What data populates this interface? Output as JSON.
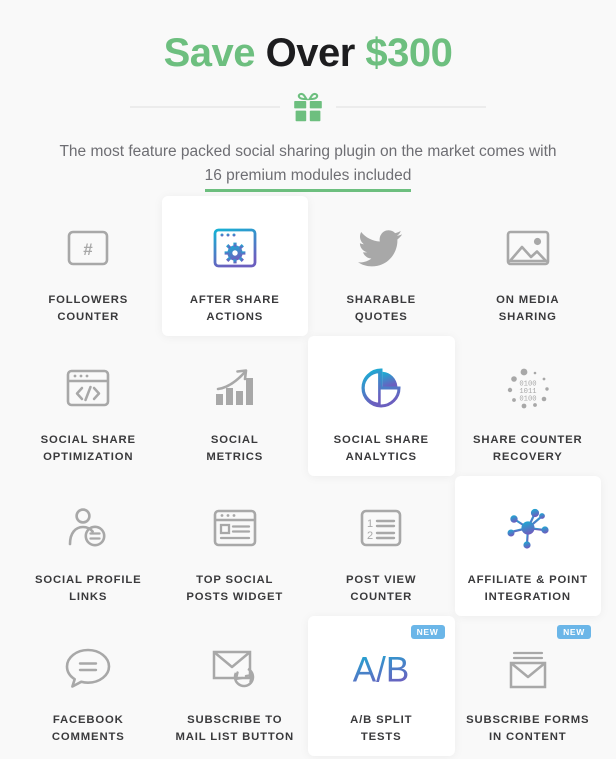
{
  "header": {
    "title_part1": "Save",
    "title_part2": "Over",
    "title_part3": "$300",
    "gift_icon": "gift-icon",
    "subtitle_line1": "The most feature packed social sharing plugin on the market comes with",
    "subtitle_highlight": "16 premium modules included"
  },
  "colors": {
    "green": "#6dbf7f",
    "dark": "#1d1d1f",
    "label": "#3a3a3c",
    "subtitle": "#6e6e73",
    "badge_blue": "#6bb6e8",
    "gradient_start": "#16b1d4",
    "gradient_end": "#6b5fbf",
    "icon_gray": "#a8a8a8",
    "page_bg": "#f9f9f9",
    "card_bg": "#ffffff"
  },
  "modules": [
    {
      "label": "FOLLOWERS\nCOUNTER",
      "icon": "hash-square-icon",
      "featured": false,
      "badge": null
    },
    {
      "label": "AFTER SHARE\nACTIONS",
      "icon": "browser-gear-icon",
      "featured": true,
      "badge": null
    },
    {
      "label": "SHARABLE\nQUOTES",
      "icon": "twitter-bird-icon",
      "featured": false,
      "badge": null
    },
    {
      "label": "ON MEDIA\nSHARING",
      "icon": "image-photo-icon",
      "featured": false,
      "badge": null
    },
    {
      "label": "SOCIAL SHARE\nOPTIMIZATION",
      "icon": "browser-code-icon",
      "featured": false,
      "badge": null
    },
    {
      "label": "SOCIAL\nMETRICS",
      "icon": "bar-chart-arrow-icon",
      "featured": false,
      "badge": null
    },
    {
      "label": "SOCIAL SHARE\nANALYTICS",
      "icon": "pie-chart-icon",
      "featured": true,
      "badge": null
    },
    {
      "label": "SHARE COUNTER\nRECOVERY",
      "icon": "binary-dots-icon",
      "featured": false,
      "badge": null
    },
    {
      "label": "SOCIAL PROFILE\nLINKS",
      "icon": "person-chat-icon",
      "featured": false,
      "badge": null
    },
    {
      "label": "TOP SOCIAL\nPOSTS WIDGET",
      "icon": "browser-list-icon",
      "featured": false,
      "badge": null
    },
    {
      "label": "POST VIEW\nCOUNTER",
      "icon": "numbered-list-icon",
      "featured": false,
      "badge": null
    },
    {
      "label": "AFFILIATE & POINT\nINTEGRATION",
      "icon": "network-nodes-icon",
      "featured": true,
      "badge": null
    },
    {
      "label": "FACEBOOK\nCOMMENTS",
      "icon": "chat-bubble-icon",
      "featured": false,
      "badge": null
    },
    {
      "label": "SUBSCRIBE TO\nMAIL LIST BUTTON",
      "icon": "envelope-refresh-icon",
      "featured": false,
      "badge": null
    },
    {
      "label": "A/B SPLIT\nTESTS",
      "icon": "ab-split-icon",
      "featured": true,
      "badge": "NEW"
    },
    {
      "label": "SUBSCRIBE FORMS\nIN CONTENT",
      "icon": "envelope-lines-icon",
      "featured": false,
      "badge": "NEW"
    }
  ]
}
